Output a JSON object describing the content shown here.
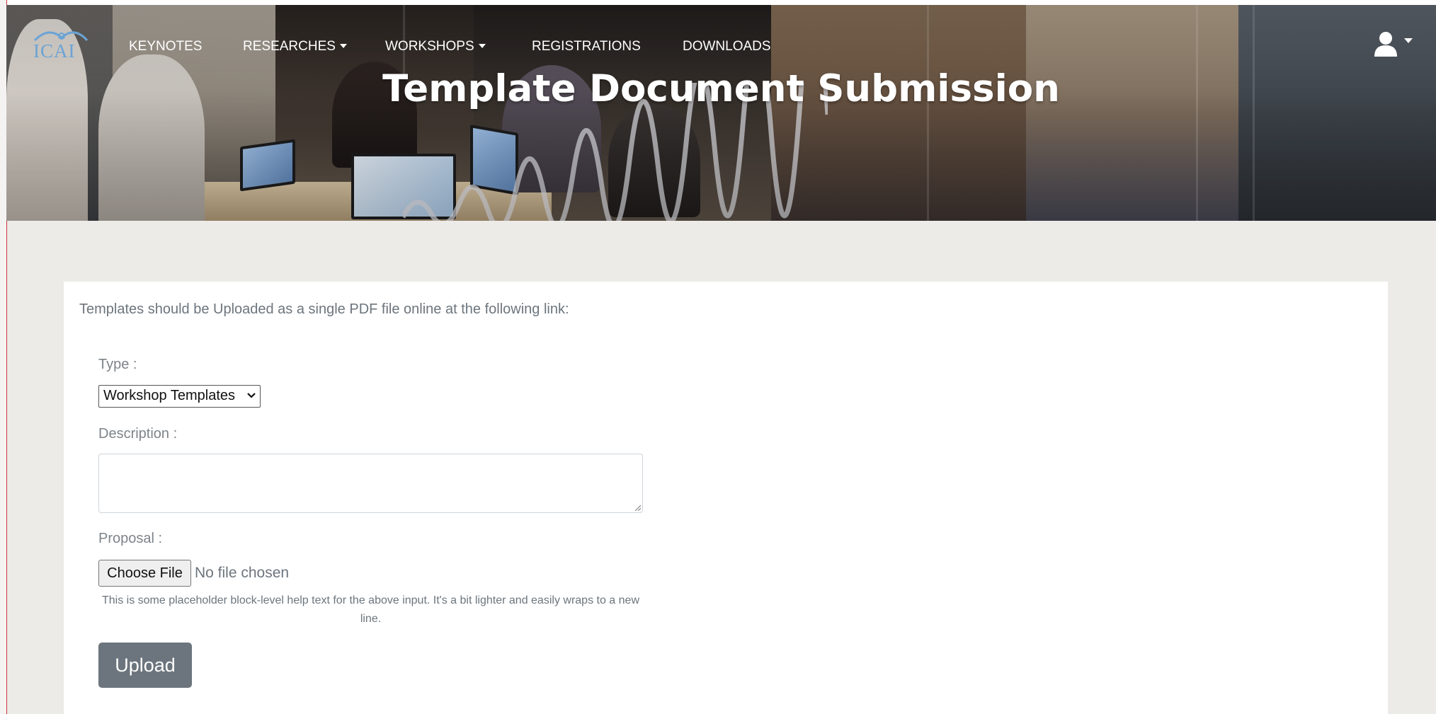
{
  "nav": {
    "logo_text": "ICAI",
    "items": [
      {
        "label": "KEYNOTES",
        "dropdown": false
      },
      {
        "label": "RESEARCHES",
        "dropdown": true
      },
      {
        "label": "WORKSHOPS",
        "dropdown": true
      },
      {
        "label": "REGISTRATIONS",
        "dropdown": false
      },
      {
        "label": "DOWNLOADS",
        "dropdown": false
      }
    ],
    "user_icon": "user-icon"
  },
  "header": {
    "title": "Template Document Submission"
  },
  "form": {
    "intro": "Templates should be Uploaded as a single PDF file online at the following link:",
    "type_label": "Type :",
    "type_selected": "Workshop Templates",
    "description_label": "Description :",
    "description_value": "",
    "proposal_label": "Proposal :",
    "choose_file_label": "Choose File",
    "no_file_text": "No file chosen",
    "help_text": "This is some placeholder block-level help text for the above input. It's a bit lighter and easily wraps to a new line.",
    "upload_label": "Upload"
  },
  "colors": {
    "accent_secondary": "#6c757d",
    "page_bg": "#ecebe8",
    "logo_blue": "#6ba3d6"
  }
}
